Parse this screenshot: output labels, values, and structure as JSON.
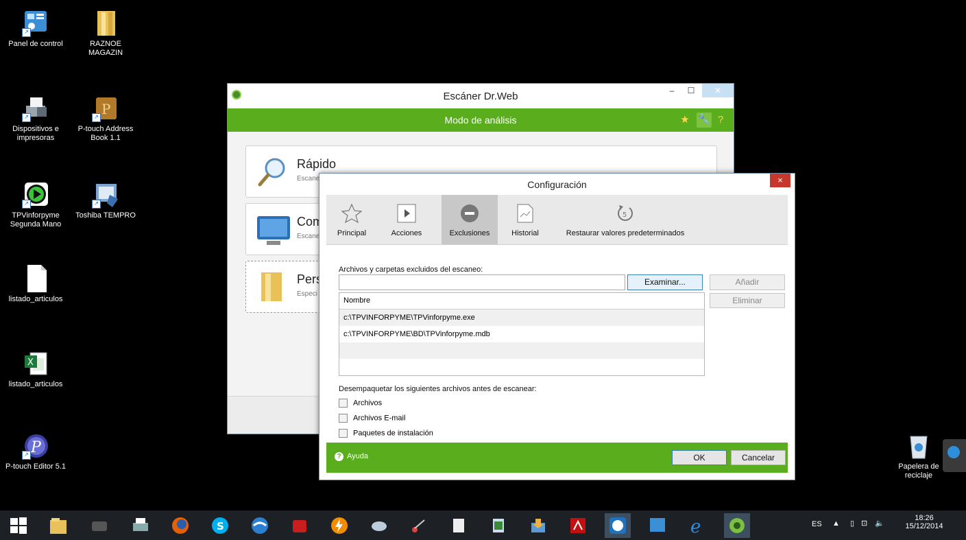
{
  "desktop_icons": [
    {
      "label": "Panel de control",
      "icon": "control-panel-icon"
    },
    {
      "label": "RAZNOE MAGAZIN",
      "icon": "folder-icon"
    },
    {
      "label": "Dispositivos e impresoras",
      "icon": "printer-icon"
    },
    {
      "label": "P-touch Address Book 1.1",
      "icon": "address-book-icon"
    },
    {
      "label": "TPVinforpyme Segunda Mano",
      "icon": "tpv-icon"
    },
    {
      "label": "Toshiba TEMPRO",
      "icon": "toshiba-icon"
    },
    {
      "label": "listado_articulos",
      "icon": "text-file-icon"
    },
    {
      "label": "listado_articulos",
      "icon": "excel-file-icon"
    },
    {
      "label": "P-touch Editor 5.1",
      "icon": "ptouch-editor-icon"
    },
    {
      "label": "Papelera de reciclaje",
      "icon": "recycle-bin-icon"
    }
  ],
  "scanner": {
    "title": "Escáner Dr.Web",
    "mode_label": "Modo de análisis",
    "options": [
      {
        "title": "Rápido",
        "subtitle": "Escane"
      },
      {
        "title": "Com",
        "subtitle": "Escane"
      },
      {
        "title": "Pers",
        "subtitle": "Especi"
      }
    ]
  },
  "config": {
    "title": "Configuración",
    "close_label": "×",
    "tabs": [
      {
        "label": "Principal",
        "icon": "star-icon"
      },
      {
        "label": "Acciones",
        "icon": "play-icon"
      },
      {
        "label": "Exclusiones",
        "icon": "minus-circle-icon"
      },
      {
        "label": "Historial",
        "icon": "chart-icon"
      },
      {
        "label": "Restaurar valores predeterminados",
        "icon": "restore-icon"
      }
    ],
    "excluded_label": "Archivos y carpetas excluidos del escaneo:",
    "path_value": "",
    "browse_label": "Examinar...",
    "add_label": "Añadir",
    "remove_label": "Eliminar",
    "column_name": "Nombre",
    "excluded_items": [
      "c:\\TPVINFORPYME\\TPVinforpyme.exe",
      "c:\\TPVINFORPYME\\BD\\TPVinforpyme.mdb"
    ],
    "unpack_label": "Desempaquetar los siguientes archivos antes de escanear:",
    "unpack_options": [
      "Archivos",
      "Archivos E-mail",
      "Paquetes de instalación"
    ],
    "help_label": "Ayuda",
    "ok_label": "OK",
    "cancel_label": "Cancelar"
  },
  "taskbar": {
    "language": "ES",
    "time": "18:26",
    "date": "15/12/2014"
  }
}
